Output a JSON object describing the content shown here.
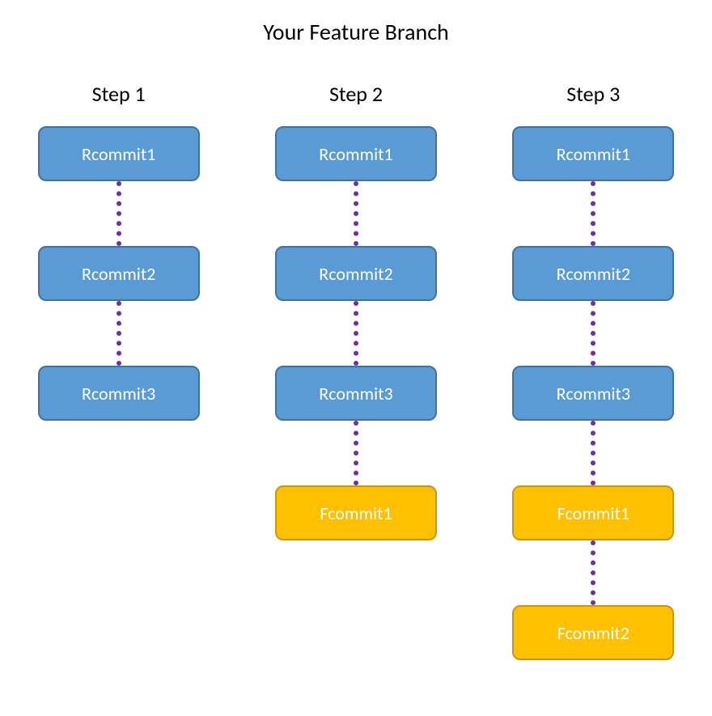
{
  "title": "Your Feature Branch",
  "colors": {
    "r_node_fill": "#5b9bd5",
    "r_node_border": "#41719c",
    "f_node_fill": "#ffc000",
    "f_node_border": "#c7951c",
    "connector": "#6f2da8"
  },
  "steps": [
    {
      "label": "Step 1",
      "nodes": [
        {
          "text": "Rcommit1",
          "kind": "blue"
        },
        {
          "text": "Rcommit2",
          "kind": "blue"
        },
        {
          "text": "Rcommit3",
          "kind": "blue"
        }
      ]
    },
    {
      "label": "Step 2",
      "nodes": [
        {
          "text": "Rcommit1",
          "kind": "blue"
        },
        {
          "text": "Rcommit2",
          "kind": "blue"
        },
        {
          "text": "Rcommit3",
          "kind": "blue"
        },
        {
          "text": "Fcommit1",
          "kind": "yellow"
        }
      ]
    },
    {
      "label": "Step 3",
      "nodes": [
        {
          "text": "Rcommit1",
          "kind": "blue"
        },
        {
          "text": "Rcommit2",
          "kind": "blue"
        },
        {
          "text": "Rcommit3",
          "kind": "blue"
        },
        {
          "text": "Fcommit1",
          "kind": "yellow"
        },
        {
          "text": "Fcommit2",
          "kind": "yellow"
        }
      ]
    }
  ]
}
